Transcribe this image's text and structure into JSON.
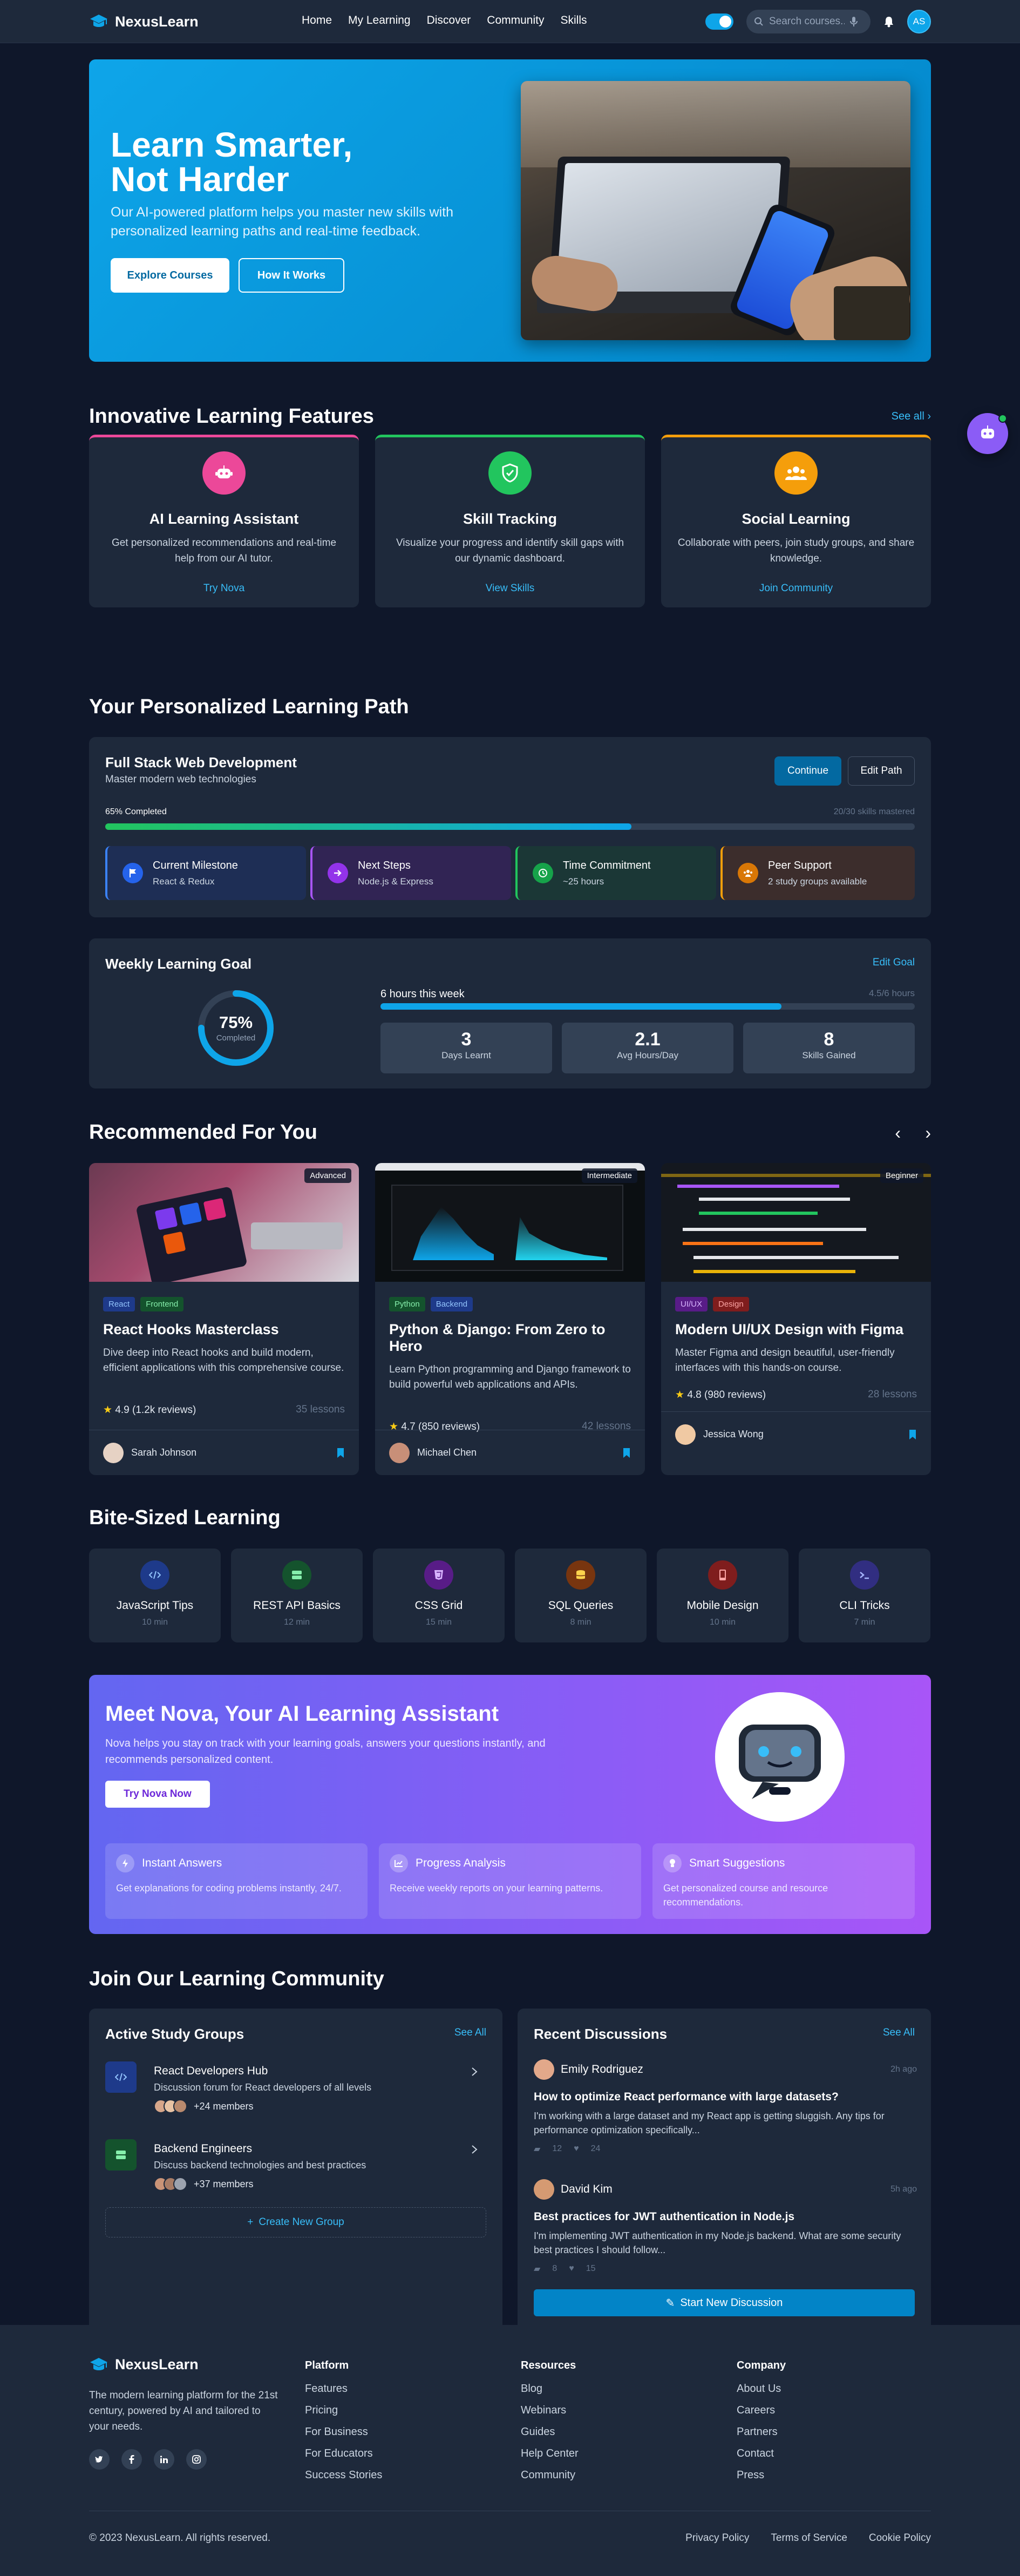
{
  "header": {
    "brand": "NexusLearn",
    "nav": [
      "Home",
      "My Learning",
      "Discover",
      "Community",
      "Skills"
    ],
    "search_placeholder": "Search courses...",
    "user_initials": "AS"
  },
  "hero": {
    "title_line1": "Learn Smarter,",
    "title_line2": "Not Harder",
    "subtitle": "Our AI-powered platform helps you master new skills with personalized learning paths and real-time feedback.",
    "primary_button": "Explore Courses",
    "secondary_button": "How It Works"
  },
  "features": {
    "title": "Innovative Learning Features",
    "see_all": "See all",
    "items": [
      {
        "title": "AI Learning Assistant",
        "desc": "Get personalized recommendations and real-time help from our AI tutor.",
        "link": "Try Nova",
        "accent": "#ec4899",
        "icon": "robot-icon"
      },
      {
        "title": "Skill Tracking",
        "desc": "Visualize your progress and identify skill gaps with our dynamic dashboard.",
        "link": "View Skills",
        "accent": "#22c55e",
        "icon": "shield-check-icon"
      },
      {
        "title": "Social Learning",
        "desc": "Collaborate with peers, join study groups, and share knowledge.",
        "link": "Join Community",
        "accent": "#f59e0b",
        "icon": "users-icon"
      }
    ]
  },
  "path": {
    "title": "Your Personalized Learning Path",
    "course_title": "Full Stack Web Development",
    "course_sub": "Master modern web technologies",
    "continue": "Continue",
    "edit": "Edit Path",
    "progress_label": "65% Completed",
    "progress_value": 0.65,
    "skills_mastered": "20/30 skills mastered",
    "milestones": [
      {
        "title": "Current Milestone",
        "sub": "React & Redux",
        "icon": "flag-icon"
      },
      {
        "title": "Next Steps",
        "sub": "Node.js & Express",
        "icon": "arrow-right-icon"
      },
      {
        "title": "Time Commitment",
        "sub": "~25 hours",
        "icon": "clock-icon"
      },
      {
        "title": "Peer Support",
        "sub": "2 study groups available",
        "icon": "users-icon"
      }
    ]
  },
  "weekly": {
    "title": "Weekly Learning Goal",
    "edit": "Edit Goal",
    "percent": "75%",
    "percent_value": 0.75,
    "completed": "Completed",
    "hours_label": "6 hours this week",
    "hours_progress": "4.5/6 hours",
    "stats": [
      {
        "value": "3",
        "label": "Days Learnt"
      },
      {
        "value": "2.1",
        "label": "Avg Hours/Day"
      },
      {
        "value": "8",
        "label": "Skills Gained"
      }
    ]
  },
  "recommended": {
    "title": "Recommended For You",
    "courses": [
      {
        "level": "Advanced",
        "tags": [
          "React",
          "Frontend"
        ],
        "title": "React Hooks Masterclass",
        "desc": "Dive deep into React hooks and build modern, efficient applications with this comprehensive course.",
        "rating": "4.9 (1.2k reviews)",
        "lessons": "35 lessons",
        "instructor": "Sarah Johnson"
      },
      {
        "level": "Intermediate",
        "tags": [
          "Python",
          "Backend"
        ],
        "title": "Python & Django: From Zero to Hero",
        "desc": "Learn Python programming and Django framework to build powerful web applications and APIs.",
        "rating": "4.7 (850 reviews)",
        "lessons": "42 lessons",
        "instructor": "Michael Chen"
      },
      {
        "level": "Beginner",
        "tags": [
          "UI/UX",
          "Design"
        ],
        "title": "Modern UI/UX Design with Figma",
        "desc": "Master Figma and design beautiful, user-friendly interfaces with this hands-on course.",
        "rating": "4.8 (980 reviews)",
        "lessons": "28 lessons",
        "instructor": "Jessica Wong"
      }
    ]
  },
  "bite": {
    "title": "Bite-Sized Learning",
    "items": [
      {
        "title": "JavaScript Tips",
        "dur": "10 min",
        "color": "#1e3a8a",
        "icon": "code-icon"
      },
      {
        "title": "REST API Basics",
        "dur": "12 min",
        "color": "#14532d",
        "icon": "server-icon"
      },
      {
        "title": "CSS Grid",
        "dur": "15 min",
        "color": "#581c87",
        "icon": "css-icon"
      },
      {
        "title": "SQL Queries",
        "dur": "8 min",
        "color": "#78350f",
        "icon": "database-icon"
      },
      {
        "title": "Mobile Design",
        "dur": "10 min",
        "color": "#7f1d1d",
        "icon": "mobile-icon"
      },
      {
        "title": "CLI Tricks",
        "dur": "7 min",
        "color": "#312e81",
        "icon": "terminal-icon"
      }
    ]
  },
  "nova": {
    "title": "Meet Nova, Your AI Learning Assistant",
    "desc": "Nova helps you stay on track with your learning goals, answers your questions instantly, and recommends personalized content.",
    "button": "Try Nova Now",
    "features": [
      {
        "title": "Instant Answers",
        "desc": "Get explanations for coding problems instantly, 24/7.",
        "icon": "bolt-icon"
      },
      {
        "title": "Progress Analysis",
        "desc": "Receive weekly reports on your learning patterns.",
        "icon": "chart-icon"
      },
      {
        "title": "Smart Suggestions",
        "desc": "Get personalized course and resource recommendations.",
        "icon": "lightbulb-icon"
      }
    ]
  },
  "community": {
    "title": "Join Our Learning Community",
    "groups_title": "Active Study Groups",
    "see_all": "See All",
    "groups": [
      {
        "name": "React Developers Hub",
        "desc": "Discussion forum for React developers of all levels",
        "members": "+24 members",
        "icon": "code-icon"
      },
      {
        "name": "Backend Engineers",
        "desc": "Discuss backend technologies and best practices",
        "members": "+37 members",
        "icon": "server-icon"
      }
    ],
    "create_group": "Create New Group",
    "discussions_title": "Recent Discussions",
    "discussions": [
      {
        "author": "Emily Rodriguez",
        "time": "2h ago",
        "title": "How to optimize React performance with large datasets?",
        "body": "I'm working with a large dataset and my React app is getting sluggish. Any tips for performance optimization specifically...",
        "comments": "12",
        "likes": "24"
      },
      {
        "author": "David Kim",
        "time": "5h ago",
        "title": "Best practices for JWT authentication in Node.js",
        "body": "I'm implementing JWT authentication in my Node.js backend. What are some security best practices I should follow...",
        "comments": "8",
        "likes": "15"
      }
    ],
    "start_discussion": "Start New Discussion"
  },
  "footer": {
    "brand": "NexusLearn",
    "tagline": "The modern learning platform for the 21st century, powered by AI and tailored to your needs.",
    "social": [
      "twitter-icon",
      "facebook-icon",
      "linkedin-icon",
      "instagram-icon"
    ],
    "columns": [
      {
        "title": "Platform",
        "links": [
          "Features",
          "Pricing",
          "For Business",
          "For Educators",
          "Success Stories"
        ]
      },
      {
        "title": "Resources",
        "links": [
          "Blog",
          "Webinars",
          "Guides",
          "Help Center",
          "Community"
        ]
      },
      {
        "title": "Company",
        "links": [
          "About Us",
          "Careers",
          "Partners",
          "Contact",
          "Press"
        ]
      }
    ],
    "copyright": "© 2023 NexusLearn. All rights reserved.",
    "legal": [
      "Privacy Policy",
      "Terms of Service",
      "Cookie Policy"
    ]
  }
}
